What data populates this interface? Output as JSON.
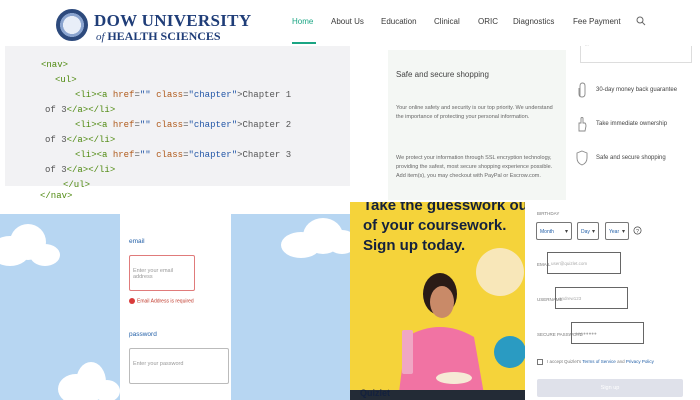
{
  "header": {
    "logo_line1": "DOW UNIVERSITY",
    "logo_of": "of",
    "logo_line2": "HEALTH SCIENCES",
    "nav": [
      {
        "label": "Home",
        "active": true
      },
      {
        "label": "About Us"
      },
      {
        "label": "Education"
      },
      {
        "label": "Clinical"
      },
      {
        "label": "ORIC"
      },
      {
        "label": "Diagnostics"
      },
      {
        "label": "Fee Payment"
      }
    ],
    "accent_color": "#1aa583"
  },
  "code": {
    "nav_open": "<nav>",
    "ul_open": "<ul>",
    "items": [
      {
        "li_open": "<li>",
        "a_open": "<a",
        "href_attr": "href",
        "href_val": "\"\"",
        "class_attr": "class",
        "class_val": "\"chapter\"",
        "text": "Chapter 1",
        "cont": "of 3",
        "close": "</a></li>"
      },
      {
        "li_open": "<li>",
        "a_open": "<a",
        "href_attr": "href",
        "href_val": "\"\"",
        "class_attr": "class",
        "class_val": "\"chapter\"",
        "text": "Chapter 2",
        "cont": "of 3",
        "close": "</a></li>"
      },
      {
        "li_open": "<li>",
        "a_open": "<a",
        "href_attr": "href",
        "href_val": "\"\"",
        "class_attr": "class",
        "class_val": "\"chapter\"",
        "text": "Chapter 3",
        "cont": "of 3",
        "close": "</a></li>"
      }
    ],
    "ul_close": "</ul>",
    "nav_close": "</nav>"
  },
  "shop": {
    "title": "Safe and secure shopping",
    "para1": "Your online safety and security is our top priority. We understand the importance of protecting your personal information.",
    "para2": "We protect your information through SSL encryption technology, providing the safest, most secure shopping experience possible. Add item(s), you may checkout with PayPal or Escrow.com."
  },
  "features": {
    "top_text": "...",
    "items": [
      {
        "label": "30-day money back guarantee"
      },
      {
        "label": "Take immediate ownership"
      },
      {
        "label": "Safe and secure shopping"
      }
    ]
  },
  "login": {
    "email_label": "email",
    "email_placeholder": "Enter your email address",
    "email_error": "Email Address is required",
    "password_label": "password",
    "password_placeholder": "Enter your password"
  },
  "ad": {
    "headline_line1": "Take the guesswork out",
    "headline_line2": "of your coursework.",
    "headline_line3": "Sign up today.",
    "brand": "Quizlet"
  },
  "signup": {
    "birthday_label": "BIRTHDAY",
    "month": "Month",
    "day": "Day",
    "year": "Year",
    "email_label": "EMAIL",
    "email_placeholder": "user@quizlet.com",
    "username_label": "USERNAME",
    "username_placeholder": "andrew123",
    "password_label": "SECURE PASSWORD",
    "password_placeholder": "●●●●●●●●",
    "terms_prefix": "I accept Quizlet's",
    "terms_link": "Terms of Service",
    "terms_and": "and",
    "privacy_link": "Privacy Policy",
    "submit": "Sign up"
  }
}
